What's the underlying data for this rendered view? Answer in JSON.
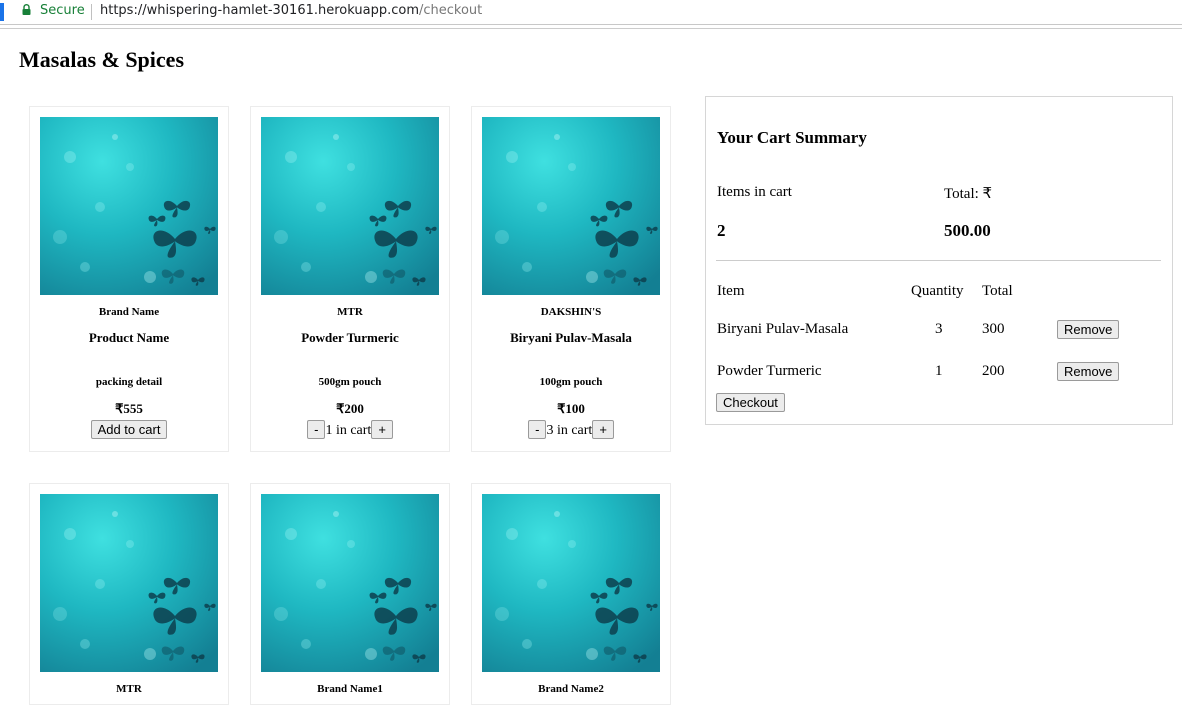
{
  "browser": {
    "secure_label": "Secure",
    "url_host": "https://whispering-hamlet-30161.herokuapp.com",
    "url_path": "/checkout"
  },
  "page": {
    "title": "Masalas & Spices"
  },
  "products": [
    {
      "brand": "Brand Name",
      "name": "Product Name",
      "packing": "packing detail",
      "price": "₹555",
      "action": "add",
      "add_label": "Add to cart"
    },
    {
      "brand": "MTR",
      "name": "Powder Turmeric",
      "packing": "500gm pouch",
      "price": "₹200",
      "action": "qty",
      "minus": "-",
      "qty_text": "1 in cart",
      "plus": "+"
    },
    {
      "brand": "DAKSHIN'S",
      "name": "Biryani Pulav-Masala",
      "packing": "100gm pouch",
      "price": "₹100",
      "action": "qty",
      "minus": "-",
      "qty_text": "3 in cart",
      "plus": "+"
    },
    {
      "brand": "MTR"
    },
    {
      "brand": "Brand Name1"
    },
    {
      "brand": "Brand Name2"
    }
  ],
  "cart": {
    "heading": "Your Cart Summary",
    "items_label": "Items in cart",
    "total_label": "Total: ₹",
    "items_count": "2",
    "total_value": "500.00",
    "columns": {
      "item": "Item",
      "quantity": "Quantity",
      "total": "Total"
    },
    "rows": [
      {
        "item": "Biryani Pulav-Masala",
        "quantity": "3",
        "total": "300",
        "remove_label": "Remove"
      },
      {
        "item": "Powder Turmeric",
        "quantity": "1",
        "total": "200",
        "remove_label": "Remove"
      }
    ],
    "checkout_label": "Checkout"
  },
  "icons": {
    "lock": "lock-icon",
    "product_image": "butterfly-teal-image"
  },
  "colors": {
    "secure_green": "#188038",
    "image_teal": "#27c3c9"
  }
}
